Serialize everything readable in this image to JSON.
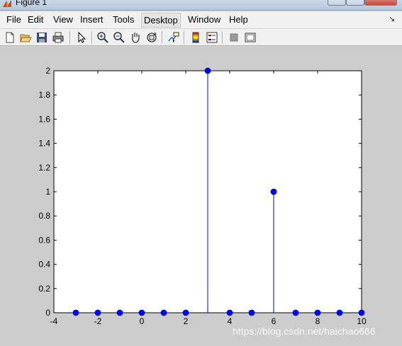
{
  "window": {
    "title": "Figure 1"
  },
  "menu": {
    "items": [
      "File",
      "Edit",
      "View",
      "Insert",
      "Tools",
      "Desktop",
      "Window",
      "Help"
    ],
    "active_index": 5
  },
  "toolbar": {
    "icons": [
      "new-figure-icon",
      "open-file-icon",
      "save-icon",
      "print-icon",
      "edit-plot-arrow-icon",
      "zoom-in-icon",
      "zoom-out-icon",
      "pan-hand-icon",
      "rotate-3d-icon",
      "data-cursor-icon",
      "colorbar-icon",
      "legend-icon",
      "hide-plot-tools-icon",
      "show-plot-tools-icon"
    ]
  },
  "chart_data": {
    "type": "scatter",
    "style": "stem",
    "x": [
      -3,
      -2,
      -1,
      0,
      1,
      2,
      3,
      4,
      5,
      6,
      7,
      8,
      9,
      10
    ],
    "y": [
      0,
      0,
      0,
      0,
      0,
      0,
      2,
      0,
      0,
      1,
      0,
      0,
      0,
      0
    ],
    "xlim": [
      -4,
      10
    ],
    "ylim": [
      0,
      2
    ],
    "xticks": [
      "-4",
      "-2",
      "0",
      "2",
      "4",
      "6",
      "8",
      "10"
    ],
    "yticks": [
      "0",
      "0.2",
      "0.4",
      "0.6",
      "0.8",
      "1",
      "1.2",
      "1.4",
      "1.6",
      "1.8",
      "2"
    ],
    "title": "",
    "xlabel": "",
    "ylabel": "",
    "grid": false,
    "marker_color": "#0000ff",
    "axes_background": "#ffffff",
    "figure_background": "#cccccc"
  },
  "watermark": "https://blog.csdn.net/haichao666"
}
